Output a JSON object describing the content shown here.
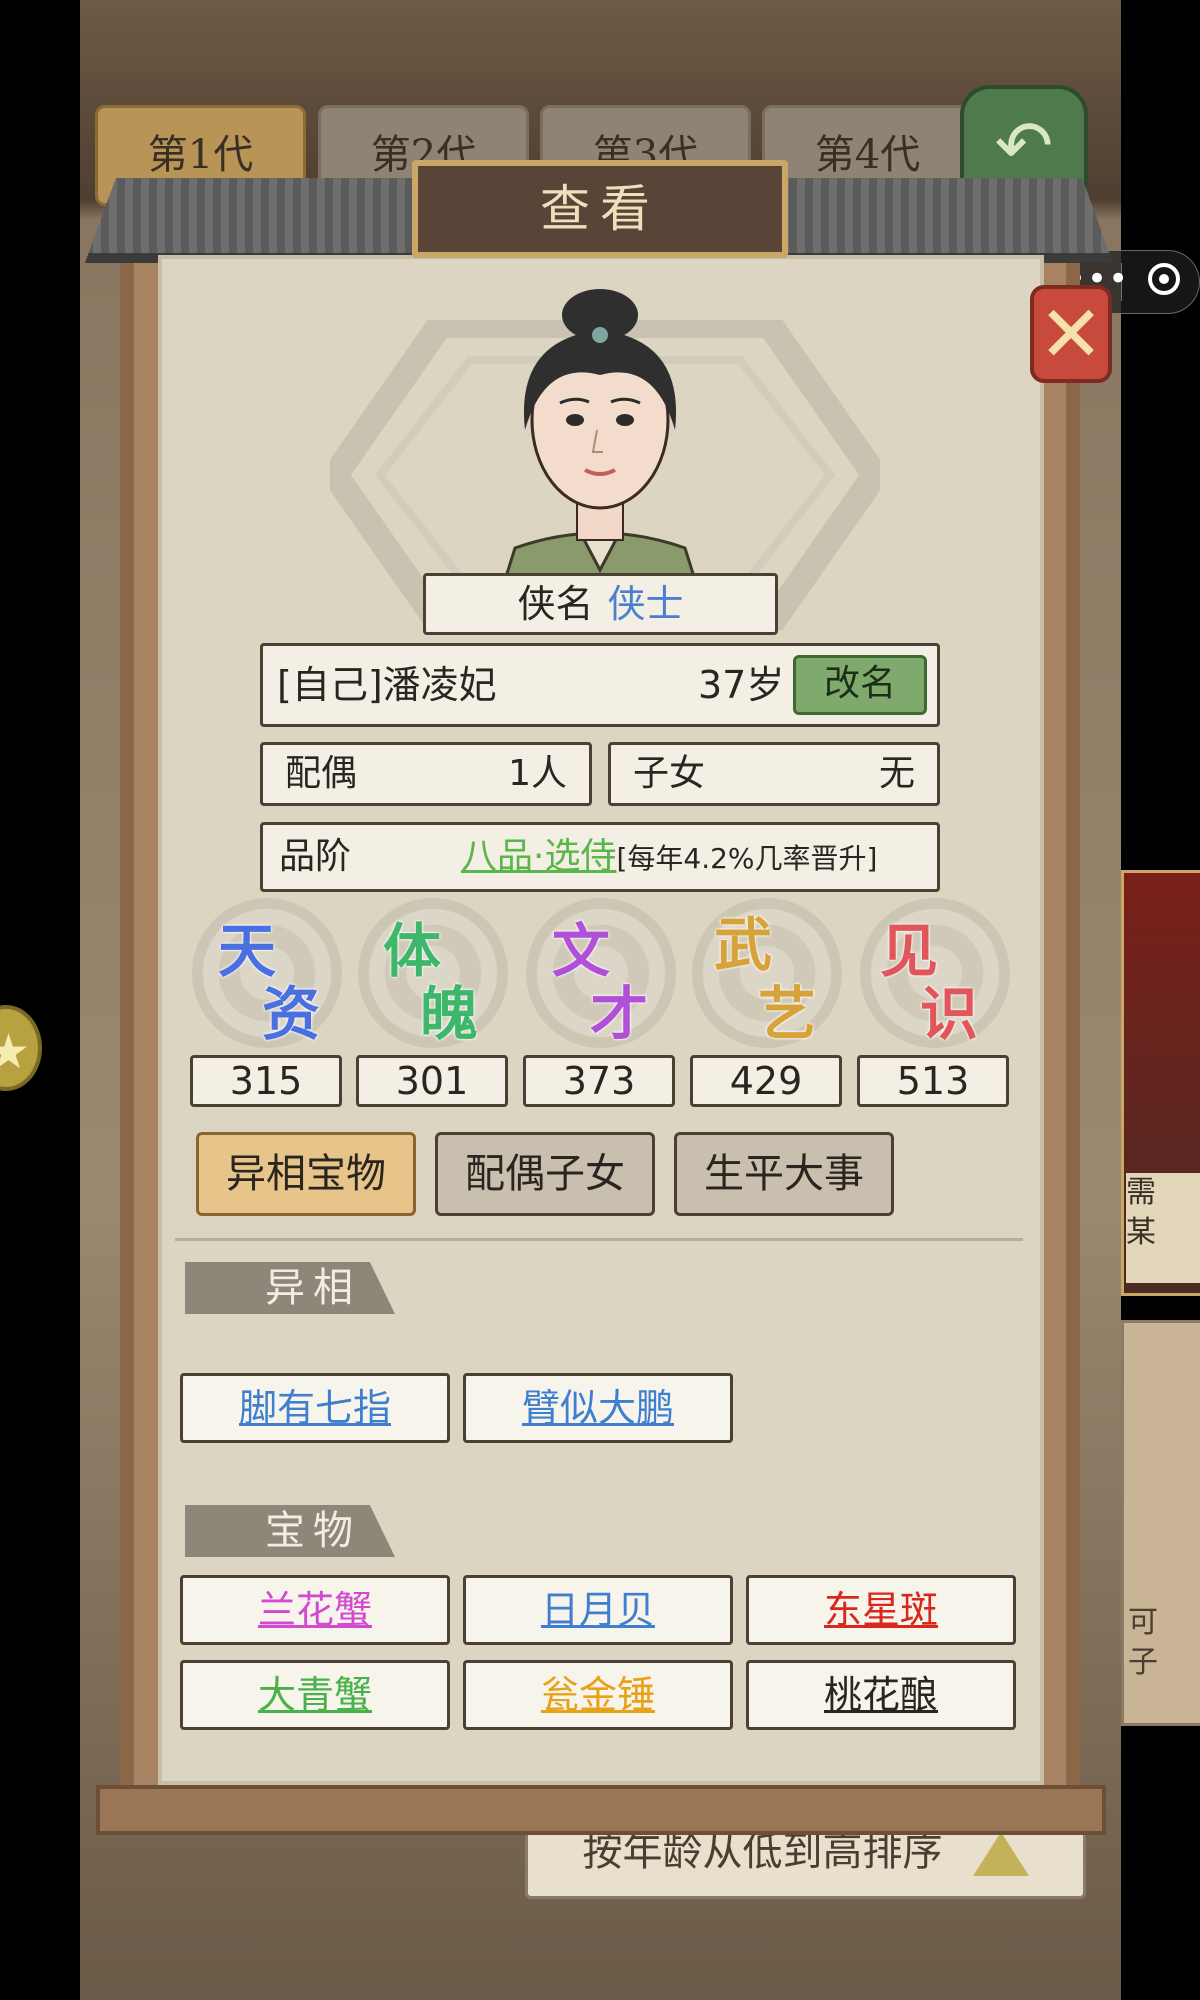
{
  "generation_tabs": [
    "第1代",
    "第2代",
    "第3代",
    "第4代"
  ],
  "sort_bar": "按年龄从低到高排序",
  "side_panel_text": [
    "需",
    "某",
    "可",
    "子"
  ],
  "modal": {
    "title": "查看",
    "close_label": "✕",
    "title_label": "侠名",
    "title_value": "侠士",
    "name": "[自己]潘凌妃",
    "age": "37岁",
    "rename_label": "改名",
    "spouse_label": "配偶",
    "spouse_value": "1人",
    "children_label": "子女",
    "children_value": "无",
    "rank_label": "品阶",
    "rank_value": "八品·选侍",
    "rank_note": "[每年4.2%几率晋升]"
  },
  "stats": [
    {
      "c1": "天",
      "c2": "资",
      "value": "315",
      "color": "#4a6fe0"
    },
    {
      "c1": "体",
      "c2": "魄",
      "value": "301",
      "color": "#3fb76b"
    },
    {
      "c1": "文",
      "c2": "才",
      "value": "373",
      "color": "#b04fd8"
    },
    {
      "c1": "武",
      "c2": "艺",
      "value": "429",
      "color": "#d8a23a"
    },
    {
      "c1": "见",
      "c2": "识",
      "value": "513",
      "color": "#e0565a"
    }
  ],
  "tabs": [
    "异相宝物",
    "配偶子女",
    "生平大事"
  ],
  "section_traits": "异相",
  "traits": [
    {
      "label": "脚有七指",
      "color": "#3f7fd0"
    },
    {
      "label": "臂似大鹏",
      "color": "#3f7fd0"
    }
  ],
  "section_treasures": "宝物",
  "treasures": [
    {
      "label": "兰花蟹",
      "color": "#d24ad0"
    },
    {
      "label": "日月贝",
      "color": "#3f7fd0"
    },
    {
      "label": "东星斑",
      "color": "#d8281e"
    },
    {
      "label": "大青蟹",
      "color": "#4ab04a"
    },
    {
      "label": "瓮金锤",
      "color": "#e8a21a"
    },
    {
      "label": "桃花酿",
      "color": "#2b2520"
    }
  ]
}
